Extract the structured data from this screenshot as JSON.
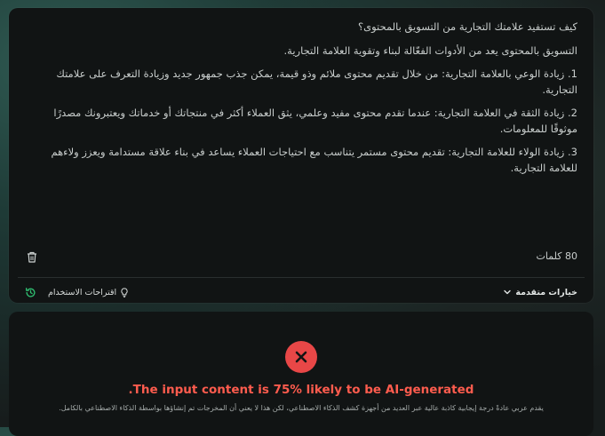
{
  "editor": {
    "question": "كيف تستفيد علامتك التجارية من التسويق بالمحتوى؟",
    "intro": "التسويق بالمحتوى يعد من الأدوات الفعّالة لبناء وتقوية العلامة التجارية.",
    "points": [
      "1. زيادة الوعي بالعلامة التجارية: من خلال تقديم محتوى ملائم وذو قيمة، يمكن جذب جمهور جديد وزيادة التعرف على علامتك التجارية.",
      "2. زيادة الثقة في العلامة التجارية: عندما تقدم محتوى مفيد وعلمي، يثق العملاء أكثر في منتجاتك أو خدماتك ويعتبرونك مصدرًا موثوقًا للمعلومات.",
      "3. زيادة الولاء للعلامة التجارية: تقديم محتوى مستمر يتناسب مع احتياجات العملاء يساعد في بناء علاقة مستدامة ويعزز ولاءهم للعلامة التجارية."
    ],
    "word_count": "80 كلمات"
  },
  "footer": {
    "advanced_options": "خيارات متقدمة",
    "usage_suggestions": "اقتراحات الاستخدام"
  },
  "result": {
    "title": ".The input content is 75% likely to be AI-generated",
    "description": "يقدم عربي عادةً درجة إيجابية كاذبة عالية عبر العديد من أجهزة كشف الذكاء الاصطناعي، لكن هذا لا يعني أن المخرجات تم إنشاؤها بواسطة الذكاء الاصطناعي بالكامل."
  },
  "colors": {
    "accent_red": "#e84747",
    "result_text": "#ff5c4e",
    "history_icon": "#2fbf71"
  }
}
